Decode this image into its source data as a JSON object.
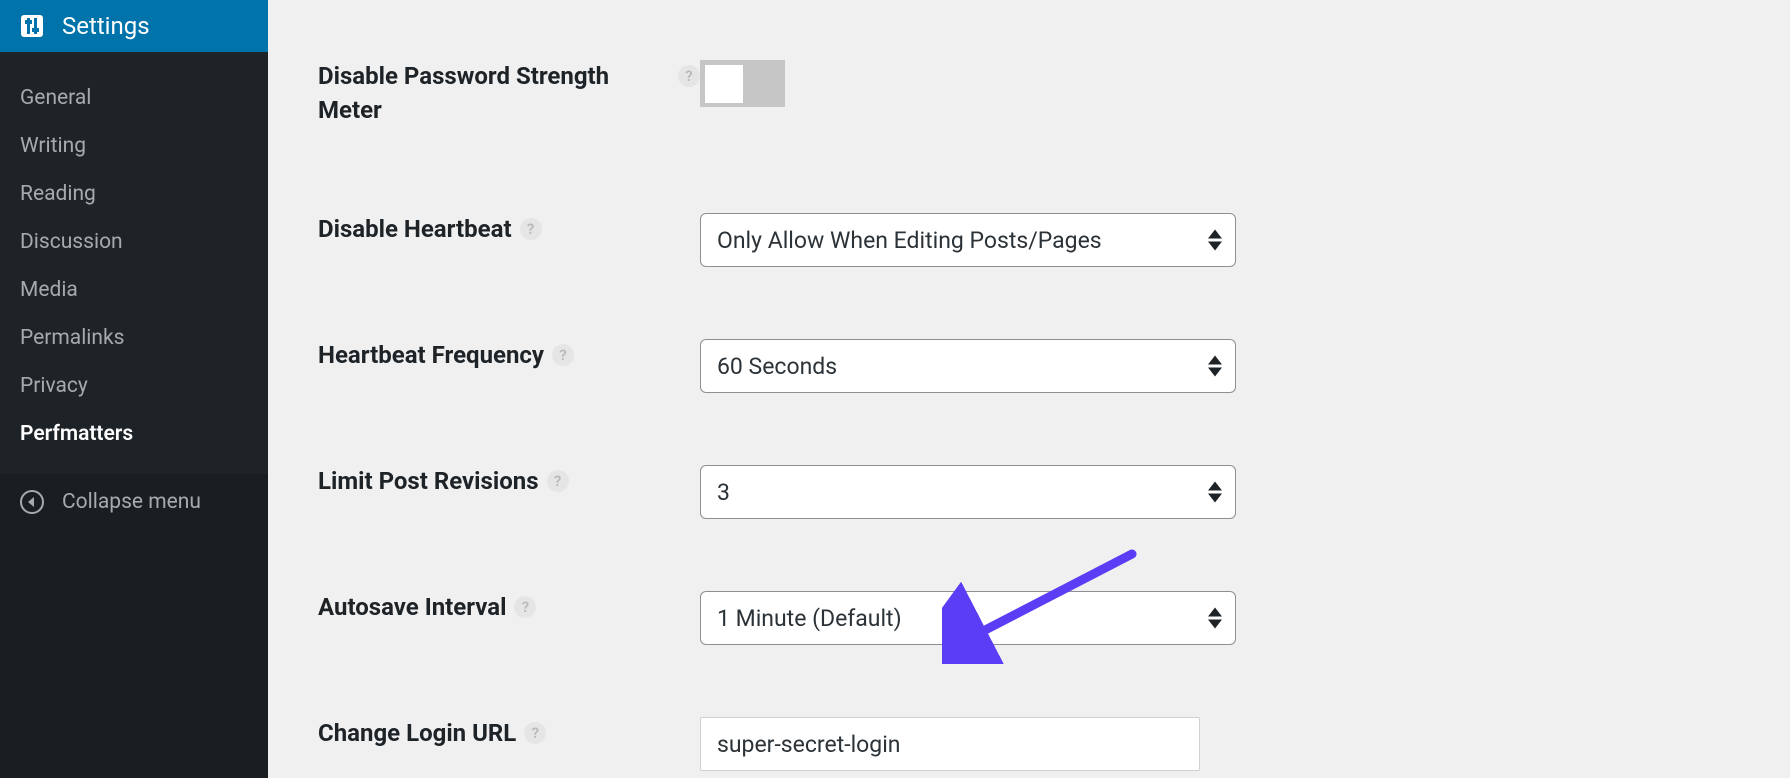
{
  "sidebar": {
    "header": "Settings",
    "items": [
      {
        "label": "General"
      },
      {
        "label": "Writing"
      },
      {
        "label": "Reading"
      },
      {
        "label": "Discussion"
      },
      {
        "label": "Media"
      },
      {
        "label": "Permalinks"
      },
      {
        "label": "Privacy"
      },
      {
        "label": "Perfmatters",
        "active": true
      }
    ],
    "collapse": "Collapse menu"
  },
  "form": {
    "disable_pwd_strength": {
      "label": "Disable Password Strength Meter"
    },
    "disable_heartbeat": {
      "label": "Disable Heartbeat",
      "value": "Only Allow When Editing Posts/Pages"
    },
    "heartbeat_frequency": {
      "label": "Heartbeat Frequency",
      "value": "60 Seconds"
    },
    "limit_post_revisions": {
      "label": "Limit Post Revisions",
      "value": "3"
    },
    "autosave_interval": {
      "label": "Autosave Interval",
      "value": "1 Minute (Default)"
    },
    "change_login_url": {
      "label": "Change Login URL",
      "value": "super-secret-login"
    }
  }
}
